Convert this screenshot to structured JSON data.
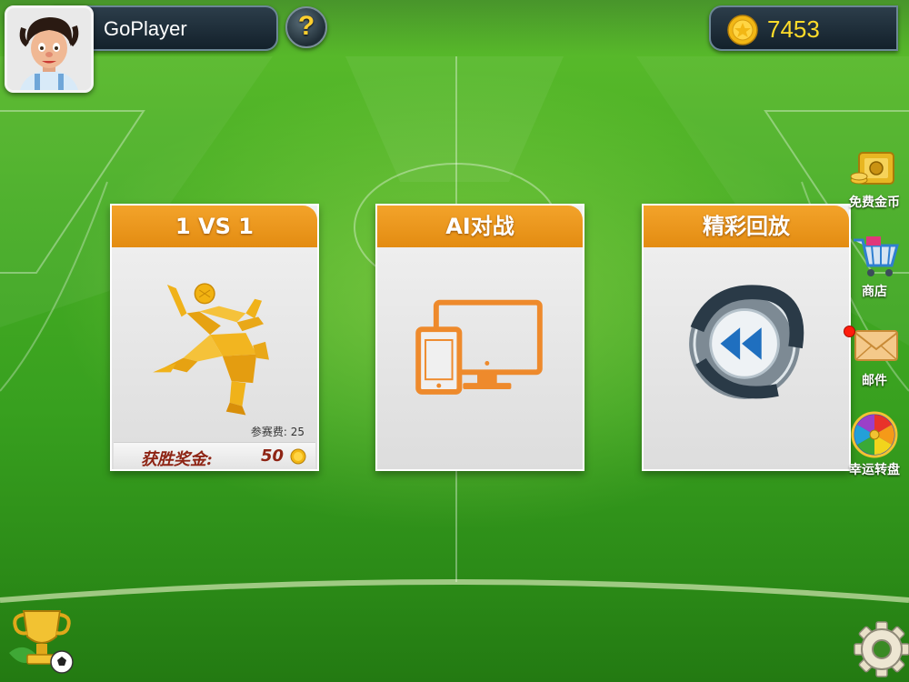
{
  "player": {
    "name": "GoPlayer",
    "avatar_icon": "cartoon-player-avatar"
  },
  "help": {
    "label": "?"
  },
  "wallet": {
    "coins": "7453",
    "icon": "gold-coin-icon"
  },
  "modes": [
    {
      "title": "1 VS 1",
      "icon": "bicycle-kick-player-icon",
      "entry_fee_label": "参赛费:",
      "entry_fee_value": "25",
      "reward_label": "获胜奖金:",
      "reward_value": "50"
    },
    {
      "title": "AI对战",
      "icon": "tablet-and-monitor-icon"
    },
    {
      "title": "精彩回放",
      "icon": "film-rewind-icon"
    }
  ],
  "side_menu": [
    {
      "label": "免费金币",
      "icon": "gold-safe-icon"
    },
    {
      "label": "商店",
      "icon": "shopping-cart-icon"
    },
    {
      "label": "邮件",
      "icon": "envelope-icon",
      "has_notice": true
    },
    {
      "label": "幸运转盘",
      "icon": "lucky-wheel-icon"
    }
  ],
  "bottom": {
    "trophy_icon": "trophy-icon",
    "settings_icon": "gear-icon"
  },
  "colors": {
    "pitch": "#3fa620",
    "card_header": "#ec9a1f",
    "coin_text": "#ffdc2a",
    "reward_text": "#8e2414"
  }
}
